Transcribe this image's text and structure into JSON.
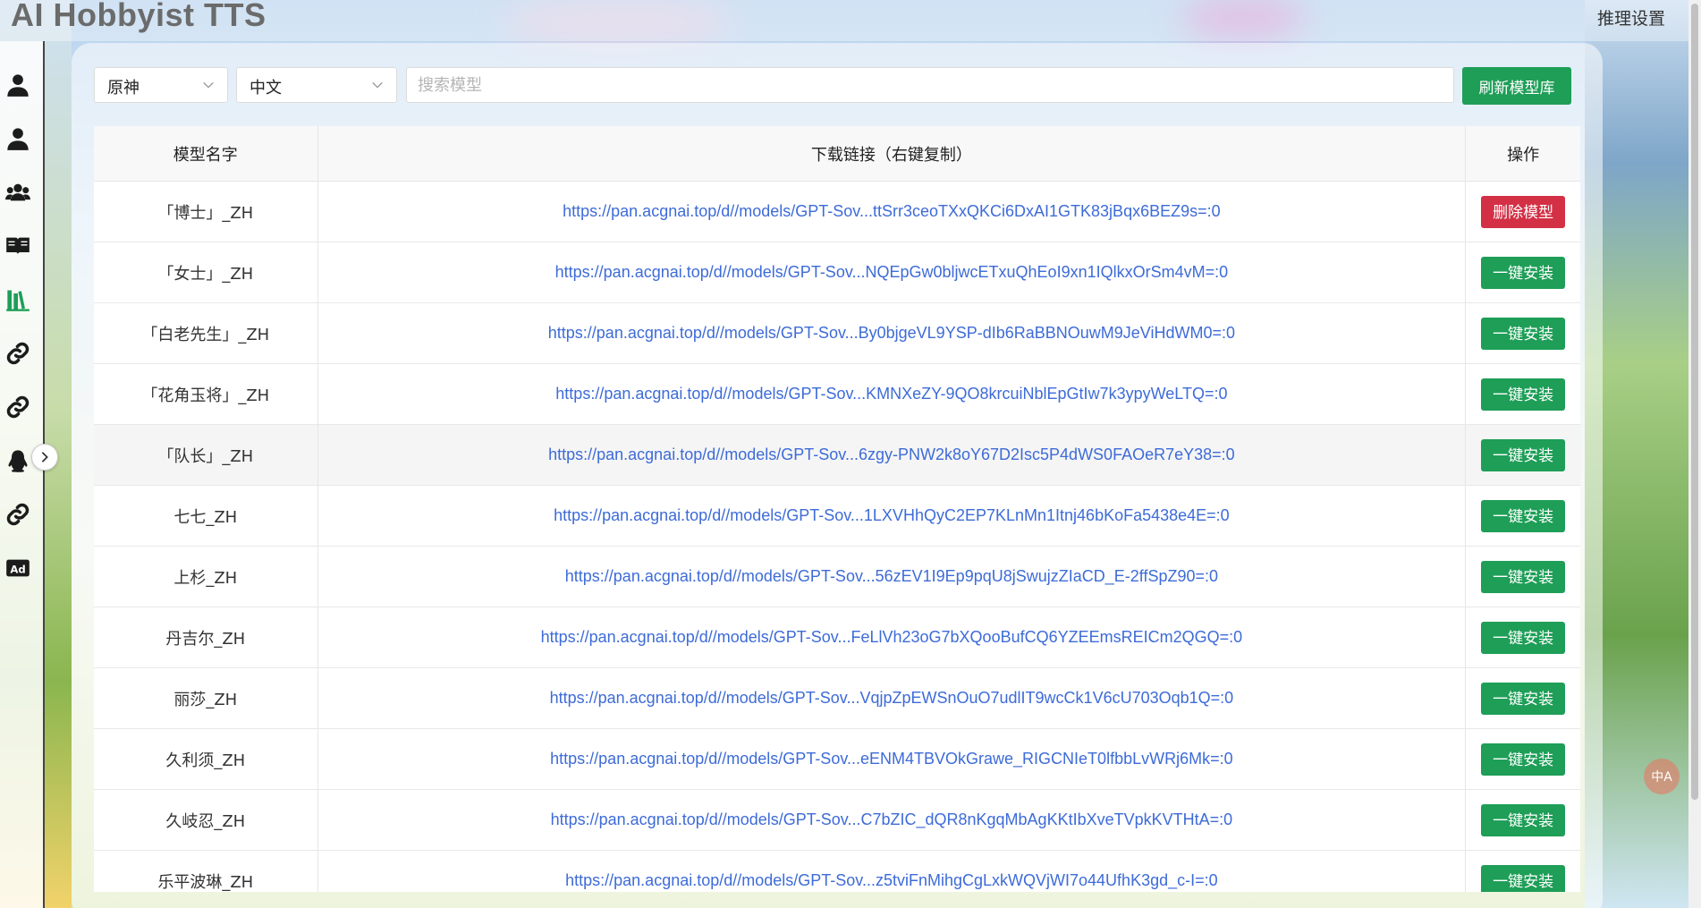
{
  "app": {
    "title": "AI Hobbyist TTS",
    "settings_label": "推理设置"
  },
  "filters": {
    "game": "原神",
    "language": "中文",
    "search_placeholder": "搜索模型",
    "refresh_label": "刷新模型库"
  },
  "sidebar": {
    "icons": [
      "user-icon",
      "user-icon",
      "users-icon",
      "book-icon",
      "library-icon",
      "link-icon",
      "link-icon",
      "qq-penguin-icon",
      "link-icon",
      "ad-icon"
    ]
  },
  "table": {
    "headers": [
      "模型名字",
      "下载链接（右键复制）",
      "操作"
    ],
    "rows": [
      {
        "name": "「博士」_ZH",
        "link": "https://pan.acgnai.top/d//models/GPT-Sov...ttSrr3ceoTXxQKCi6DxAI1GTK83jBqx6BEZ9s=:0",
        "action": "删除模型",
        "action_type": "delete"
      },
      {
        "name": "「女士」_ZH",
        "link": "https://pan.acgnai.top/d//models/GPT-Sov...NQEpGw0bljwcETxuQhEoI9xn1IQlkxOrSm4vM=:0",
        "action": "一键安装",
        "action_type": "install"
      },
      {
        "name": "「白老先生」_ZH",
        "link": "https://pan.acgnai.top/d//models/GPT-Sov...By0bjgeVL9YSP-dIb6RaBBNOuwM9JeViHdWM0=:0",
        "action": "一键安装",
        "action_type": "install"
      },
      {
        "name": "「花角玉将」_ZH",
        "link": "https://pan.acgnai.top/d//models/GPT-Sov...KMNXeZY-9QO8krcuiNblEpGtIw7k3ypyWeLTQ=:0",
        "action": "一键安装",
        "action_type": "install"
      },
      {
        "name": "「队长」_ZH",
        "link": "https://pan.acgnai.top/d//models/GPT-Sov...6zgy-PNW2k8oY67D2Isc5P4dWS0FAOeR7eY38=:0",
        "action": "一键安装",
        "action_type": "install"
      },
      {
        "name": "七七_ZH",
        "link": "https://pan.acgnai.top/d//models/GPT-Sov...1LXVHhQyC2EP7KLnMn1Itnj46bKoFa5438e4E=:0",
        "action": "一键安装",
        "action_type": "install"
      },
      {
        "name": "上杉_ZH",
        "link": "https://pan.acgnai.top/d//models/GPT-Sov...56zEV1I9Ep9pqU8jSwujzZIaCD_E-2ffSpZ90=:0",
        "action": "一键安装",
        "action_type": "install"
      },
      {
        "name": "丹吉尔_ZH",
        "link": "https://pan.acgnai.top/d//models/GPT-Sov...FeLlVh23oG7bXQooBufCQ6YZEEmsREICm2QGQ=:0",
        "action": "一键安装",
        "action_type": "install"
      },
      {
        "name": "丽莎_ZH",
        "link": "https://pan.acgnai.top/d//models/GPT-Sov...VqjpZpEWSnOuO7udlIT9wcCk1V6cU703Oqb1Q=:0",
        "action": "一键安装",
        "action_type": "install"
      },
      {
        "name": "久利须_ZH",
        "link": "https://pan.acgnai.top/d//models/GPT-Sov...eENM4TBVOkGrawe_RIGCNIeT0lfbbLvWRj6Mk=:0",
        "action": "一键安装",
        "action_type": "install"
      },
      {
        "name": "久岐忍_ZH",
        "link": "https://pan.acgnai.top/d//models/GPT-Sov...C7bZIC_dQR8nKgqMbAgKKtIbXveTVpkKVTHtA=:0",
        "action": "一键安装",
        "action_type": "install"
      },
      {
        "name": "乐平波琳_ZH",
        "link": "https://pan.acgnai.top/d//models/GPT-Sov...z5tviFnMihgCgLxkWQVjWI7o44UfhK3gd_c-I=:0",
        "action": "一键安装",
        "action_type": "install"
      }
    ]
  },
  "colors": {
    "install": "#1e9e57",
    "delete": "#d32f45",
    "link": "#3d6bd8"
  }
}
